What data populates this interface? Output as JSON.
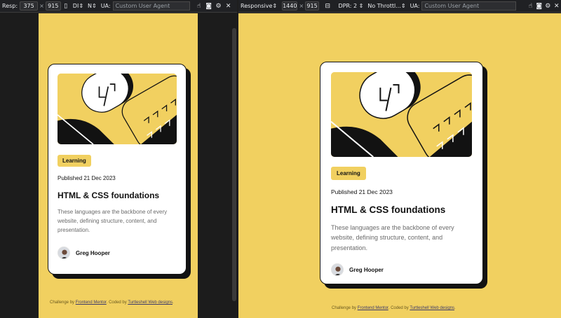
{
  "devtools_left": {
    "mode_label": "Resp",
    "width_value": "375",
    "times": "×",
    "height_value": "915",
    "dpr_label": "DI",
    "throttle_label": "N",
    "ua_label": "UA:",
    "ua_placeholder": "Custom User Agent"
  },
  "devtools_right": {
    "mode_label": "Responsive",
    "width_value": "1440",
    "times": "×",
    "height_value": "915",
    "dpr_label": "DPR: 2",
    "throttle_label": "No Throttl...",
    "ua_label": "UA:",
    "ua_placeholder": "Custom User Agent"
  },
  "card": {
    "tag": "Learning",
    "published": "Published 21 Dec 2023",
    "title": "HTML & CSS foundations",
    "description": "These languages are the backbone of every website, defining structure, content, and presentation.",
    "author": "Greg Hooper"
  },
  "attribution": {
    "prefix": "Challenge by ",
    "link1": "Frontend Mentor",
    "middle": ". Coded by ",
    "link2": "Turtleshell Web designs",
    "suffix": "."
  },
  "colors": {
    "background_yellow": "#f1d060",
    "ink": "#121212",
    "grey_text": "#6b6b6b"
  }
}
